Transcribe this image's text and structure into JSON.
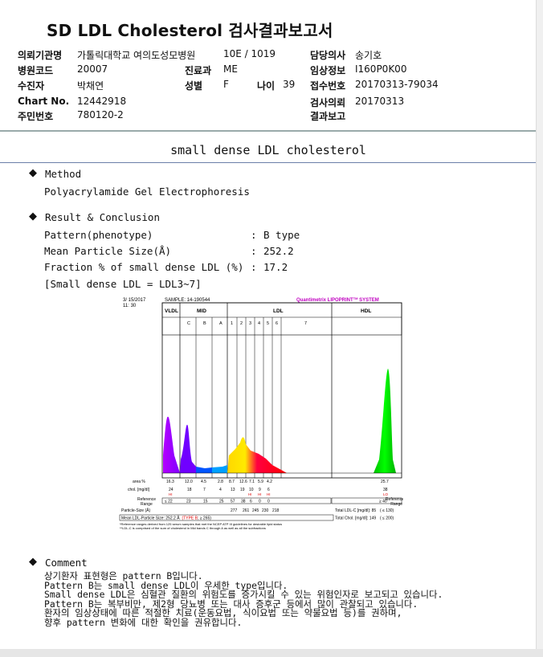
{
  "header": {
    "title": "SD LDL Cholesterol 검사결과보고서"
  },
  "info": {
    "requester_label": "의뢰기관명",
    "requester_value": "가톨릭대학교 여의도성모병원",
    "ward_value": "10E / 1019",
    "doctor_label": "담당의사",
    "doctor_value": "송기호",
    "hospital_code_label": "병원코드",
    "hospital_code_value": "20007",
    "dept_label": "진료과",
    "dept_value": "ME",
    "clinical_label": "임상정보",
    "clinical_value": "I160P0K00",
    "patient_label": "수진자",
    "patient_value": "박채연",
    "sex_label": "성별",
    "sex_value": "F",
    "age_label": "나이",
    "age_value": "39",
    "receipt_label": "접수번호",
    "receipt_value": "20170313-79034",
    "chart_label": "Chart No.",
    "chart_value": "12442918",
    "test_date_label": "검사의뢰",
    "test_date_value": "20170313",
    "resident_label": "주민번호",
    "resident_value": "780120-2",
    "report_label": "결과보고",
    "report_value": ""
  },
  "section": {
    "title": "small dense LDL cholesterol"
  },
  "method": {
    "heading": "Method",
    "text": "Polyacrylamide Gel Electrophoresis"
  },
  "result": {
    "heading": "Result & Conclusion",
    "rows": [
      {
        "label": "Pattern(phenotype)",
        "sep": ":",
        "value": "B type"
      },
      {
        "label": "Mean Particle Size(Å)",
        "sep": ":",
        "value": "252.2"
      },
      {
        "label": "Fraction % of small dense LDL (%)",
        "sep": ":",
        "value": "17.2"
      }
    ],
    "note": "[Small dense LDL = LDL3~7]"
  },
  "chart": {
    "date": "3/ 15/2017",
    "time": "11: 30",
    "sample": "SAMPLE:   14-190544",
    "brand": "Quantimetrix LIPOPRINT",
    "brand_sup": "TM",
    "brand_suffix": " SYSTEM",
    "vldl": "VLDL",
    "mid": "MID",
    "ldl": "LDL",
    "hdl": "HDL",
    "mid_bands": [
      "C",
      "B",
      "A"
    ],
    "ldl_bands": [
      "1",
      "2",
      "3",
      "4",
      "5",
      "6",
      "7"
    ],
    "area_label": "area %",
    "area_values": [
      "16.3",
      "12.0",
      "4.5",
      "2.8",
      "8.7",
      "12.6",
      "7.1",
      "5.9",
      "4.2",
      "25.7"
    ],
    "chol_label": "chol. [mg/dl]",
    "chol_values": [
      "24",
      "18",
      "7",
      "4",
      "13",
      "19",
      "10",
      "9",
      "6",
      "38"
    ],
    "flags": [
      "HI",
      "HI",
      "HI",
      "HI",
      "LO"
    ],
    "ref_label_1": "Reference",
    "ref_label_2": "Range",
    "ref_values": [
      "≤  22",
      "23",
      "15",
      "25",
      "57",
      "38",
      "6",
      "0",
      "0",
      "≥ 40"
    ],
    "ps_label": "Particle-Size (Å)",
    "ps_values": [
      "277",
      "261",
      "245",
      "230",
      "218"
    ],
    "total_ldl": "Total LDL-C [mg/dl]:  85",
    "total_ldl_ref": "( ≤ 130)",
    "mean_label": "Mean LDL-Particle Size:   252.2 Å",
    "mean_type": "(TYPE B",
    "mean_ref": "; ≥ 265)",
    "total_chol": "Total Chol. [mg/dl]:  149",
    "total_chol_ref": "( ≤ 200)",
    "foot1": "*Reference ranges derived from 125 serum samples that met the NCEP ATP III guidelines for desirable lipid status",
    "foot2": "**LDL-C is comprised of the sum of cholesterol in Mid bands C through A as well as all the subfractions"
  },
  "comment": {
    "heading": "Comment",
    "lines": [
      "상기환자 표현형은 pattern B입니다.",
      "Pattern B는 small dense LDL이 우세한 type입니다.",
      "Small dense LDL은 심혈관 질환의 위험도를 증가시킬 수 있는 위험인자로 보고되고 있습니다.",
      "Pattern B는 복부비만, 제2형 당뇨병 또는 대사 증후군 등에서 많이 관찰되고 있습니다.",
      "환자의 임상상태에 따른 적절한 치료(운동요법, 식이요법 또는 약물요법 등)를 권하며,",
      "향후 pattern 변화에 대한 확인을 권유합니다."
    ]
  }
}
